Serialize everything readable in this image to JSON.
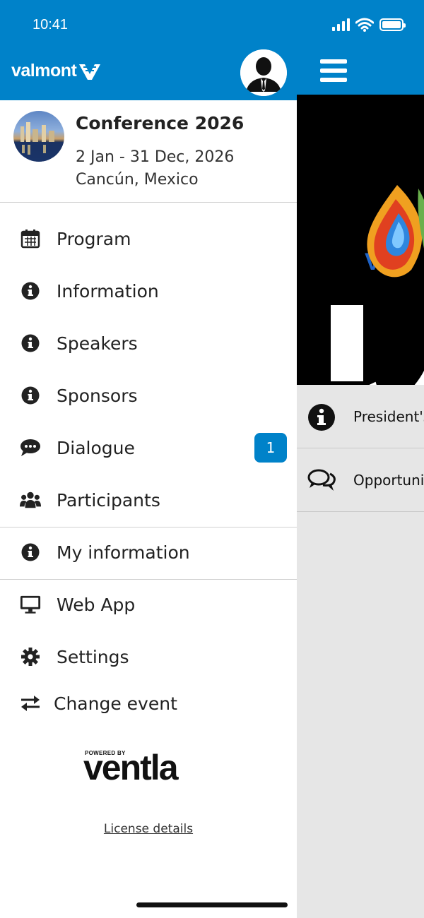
{
  "status_bar": {
    "time": "10:41"
  },
  "brand": {
    "name": "valmont"
  },
  "event": {
    "title": "Conference 2026",
    "dates": "2 Jan - 31 Dec, 2026",
    "location": "Cancún, Mexico"
  },
  "menu": {
    "items": [
      {
        "label": "Program",
        "icon": "calendar-icon"
      },
      {
        "label": "Information",
        "icon": "info-icon"
      },
      {
        "label": "Speakers",
        "icon": "info-icon"
      },
      {
        "label": "Sponsors",
        "icon": "info-icon"
      },
      {
        "label": "Dialogue",
        "icon": "chat-icon",
        "badge": "1"
      },
      {
        "label": "Participants",
        "icon": "users-icon"
      }
    ],
    "my_information": {
      "label": "My information",
      "icon": "info-icon"
    },
    "web_app": {
      "label": "Web App",
      "icon": "monitor-icon"
    },
    "settings": {
      "label": "Settings",
      "icon": "gear-icon"
    },
    "change_event": {
      "label": "Change event",
      "icon": "swap-arrows-icon"
    }
  },
  "footer": {
    "powered_by": "POWERED BY",
    "logo": "ventla",
    "license_link": "License details"
  },
  "background_app": {
    "banner_text": "VAL",
    "feed": [
      {
        "text": "President's",
        "icon": "info-icon"
      },
      {
        "text": "Opportuni",
        "icon": "chat-bubbles-icon"
      }
    ]
  },
  "colors": {
    "brand_blue": "#0082c9",
    "background_gray": "#e6e6e6"
  }
}
